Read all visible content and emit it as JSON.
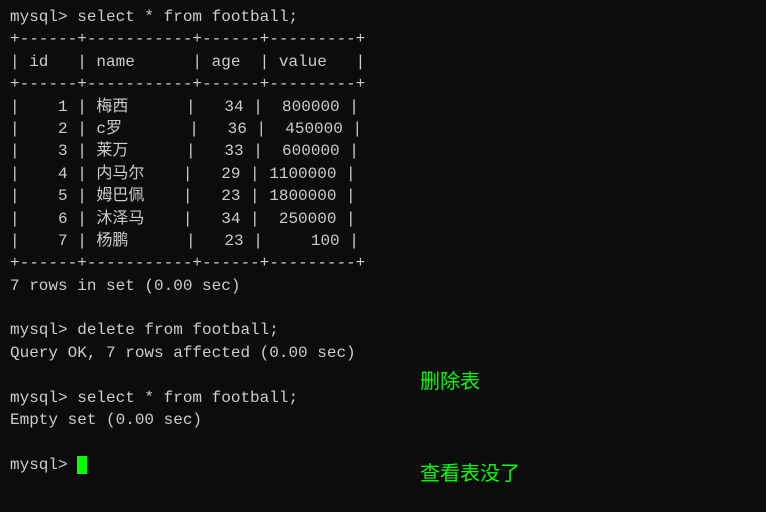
{
  "commands": {
    "select1": "mysql> select * from football;",
    "delete": "mysql> delete from football;",
    "select2": "mysql> select * from football;",
    "prompt_empty": "mysql> "
  },
  "table": {
    "border_top": "+------+-----------+------+---------+",
    "header": "| id   | name      | age  | value   |",
    "border_mid": "+------+-----------+------+---------+",
    "rows": [
      {
        "id": 1,
        "name": "梅西",
        "age": 34,
        "value": 800000
      },
      {
        "id": 2,
        "name": "c罗",
        "age": 36,
        "value": 450000
      },
      {
        "id": 3,
        "name": "莱万",
        "age": 33,
        "value": 600000
      },
      {
        "id": 4,
        "name": "内马尔",
        "age": 29,
        "value": 1100000
      },
      {
        "id": 5,
        "name": "姆巴佩",
        "age": 23,
        "value": 1800000
      },
      {
        "id": 6,
        "name": "沐泽马",
        "age": 34,
        "value": 250000
      },
      {
        "id": 7,
        "name": "杨鹏",
        "age": 23,
        "value": 100
      }
    ],
    "border_bottom": "+------+-----------+------+---------+"
  },
  "results": {
    "rows_in_set": "7 rows in set (0.00 sec)",
    "query_ok": "Query OK, 7 rows affected (0.00 sec)",
    "empty_set": "Empty set (0.00 sec)"
  },
  "annotations": {
    "delete_table": "删除表",
    "view_gone": "查看表没了"
  }
}
